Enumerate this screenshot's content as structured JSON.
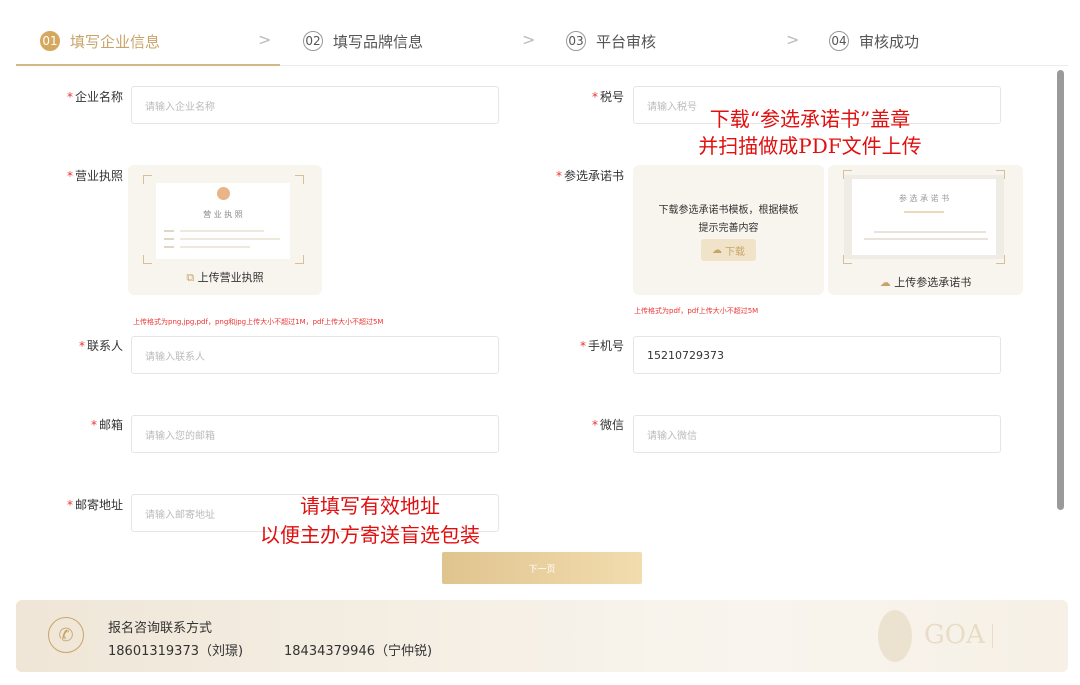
{
  "steps": [
    {
      "num": "01",
      "label": "填写企业信息"
    },
    {
      "num": "02",
      "label": "填写品牌信息"
    },
    {
      "num": "03",
      "label": "平台审核"
    },
    {
      "num": "04",
      "label": "审核成功"
    }
  ],
  "step_separator": ">",
  "form": {
    "company_name": {
      "label": "企业名称",
      "placeholder": "请输入企业名称"
    },
    "tax_number": {
      "label": "税号",
      "placeholder": "请输入税号"
    },
    "business_license": {
      "label": "营业执照",
      "card_title": "营 业 执 照",
      "upload_label": "上传营业执照",
      "hint": "上传格式为png,jpg,pdf，png和jpg上传大小不超过1M，pdf上传大小不超过5M"
    },
    "commitment": {
      "label": "参选承诺书",
      "download_desc_line1": "下载参选承诺书模板，根据模板",
      "download_desc_line2": "提示完善内容",
      "download_button": "下载",
      "card_title": "参 选 承 诺 书",
      "upload_label": "上传参选承诺书",
      "hint": "上传格式为pdf，pdf上传大小不超过5M"
    },
    "contact_person": {
      "label": "联系人",
      "placeholder": "请输入联系人"
    },
    "phone": {
      "label": "手机号",
      "value": "15210729373"
    },
    "email": {
      "label": "邮箱",
      "placeholder": "请输入您的邮箱"
    },
    "wechat": {
      "label": "微信",
      "placeholder": "请输入微信"
    },
    "mail_address": {
      "label": "邮寄地址",
      "placeholder": "请输入邮寄地址"
    }
  },
  "annotations": {
    "commitment_note_line1": "下载“参选承诺书”盖章",
    "commitment_note_line2": "并扫描做成PDF文件上传",
    "address_note_line1": "请填写有效地址",
    "address_note_line2": "以便主办方寄送盲选包装"
  },
  "next_button": "下一页",
  "contact": {
    "title": "报名咨询联系方式",
    "phone1": "18601319373（刘璟)",
    "phone2": "18434379946（宁仲锐)",
    "brand": "GOA"
  },
  "colors": {
    "accent": "#d6a85e",
    "required": "#e33333",
    "note_red": "#e01010"
  }
}
